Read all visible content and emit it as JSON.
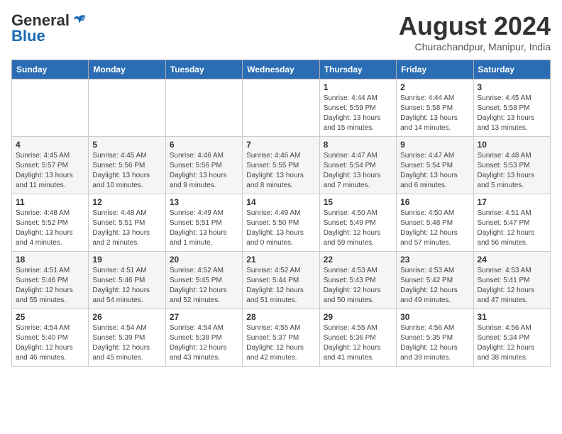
{
  "header": {
    "logo_general": "General",
    "logo_blue": "Blue",
    "month_year": "August 2024",
    "location": "Churachandpur, Manipur, India"
  },
  "weekdays": [
    "Sunday",
    "Monday",
    "Tuesday",
    "Wednesday",
    "Thursday",
    "Friday",
    "Saturday"
  ],
  "weeks": [
    [
      {
        "day": "",
        "info": ""
      },
      {
        "day": "",
        "info": ""
      },
      {
        "day": "",
        "info": ""
      },
      {
        "day": "",
        "info": ""
      },
      {
        "day": "1",
        "info": "Sunrise: 4:44 AM\nSunset: 5:59 PM\nDaylight: 13 hours\nand 15 minutes."
      },
      {
        "day": "2",
        "info": "Sunrise: 4:44 AM\nSunset: 5:58 PM\nDaylight: 13 hours\nand 14 minutes."
      },
      {
        "day": "3",
        "info": "Sunrise: 4:45 AM\nSunset: 5:58 PM\nDaylight: 13 hours\nand 13 minutes."
      }
    ],
    [
      {
        "day": "4",
        "info": "Sunrise: 4:45 AM\nSunset: 5:57 PM\nDaylight: 13 hours\nand 11 minutes."
      },
      {
        "day": "5",
        "info": "Sunrise: 4:45 AM\nSunset: 5:56 PM\nDaylight: 13 hours\nand 10 minutes."
      },
      {
        "day": "6",
        "info": "Sunrise: 4:46 AM\nSunset: 5:56 PM\nDaylight: 13 hours\nand 9 minutes."
      },
      {
        "day": "7",
        "info": "Sunrise: 4:46 AM\nSunset: 5:55 PM\nDaylight: 13 hours\nand 8 minutes."
      },
      {
        "day": "8",
        "info": "Sunrise: 4:47 AM\nSunset: 5:54 PM\nDaylight: 13 hours\nand 7 minutes."
      },
      {
        "day": "9",
        "info": "Sunrise: 4:47 AM\nSunset: 5:54 PM\nDaylight: 13 hours\nand 6 minutes."
      },
      {
        "day": "10",
        "info": "Sunrise: 4:48 AM\nSunset: 5:53 PM\nDaylight: 13 hours\nand 5 minutes."
      }
    ],
    [
      {
        "day": "11",
        "info": "Sunrise: 4:48 AM\nSunset: 5:52 PM\nDaylight: 13 hours\nand 4 minutes."
      },
      {
        "day": "12",
        "info": "Sunrise: 4:48 AM\nSunset: 5:51 PM\nDaylight: 13 hours\nand 2 minutes."
      },
      {
        "day": "13",
        "info": "Sunrise: 4:49 AM\nSunset: 5:51 PM\nDaylight: 13 hours\nand 1 minute."
      },
      {
        "day": "14",
        "info": "Sunrise: 4:49 AM\nSunset: 5:50 PM\nDaylight: 13 hours\nand 0 minutes."
      },
      {
        "day": "15",
        "info": "Sunrise: 4:50 AM\nSunset: 5:49 PM\nDaylight: 12 hours\nand 59 minutes."
      },
      {
        "day": "16",
        "info": "Sunrise: 4:50 AM\nSunset: 5:48 PM\nDaylight: 12 hours\nand 57 minutes."
      },
      {
        "day": "17",
        "info": "Sunrise: 4:51 AM\nSunset: 5:47 PM\nDaylight: 12 hours\nand 56 minutes."
      }
    ],
    [
      {
        "day": "18",
        "info": "Sunrise: 4:51 AM\nSunset: 5:46 PM\nDaylight: 12 hours\nand 55 minutes."
      },
      {
        "day": "19",
        "info": "Sunrise: 4:51 AM\nSunset: 5:46 PM\nDaylight: 12 hours\nand 54 minutes."
      },
      {
        "day": "20",
        "info": "Sunrise: 4:52 AM\nSunset: 5:45 PM\nDaylight: 12 hours\nand 52 minutes."
      },
      {
        "day": "21",
        "info": "Sunrise: 4:52 AM\nSunset: 5:44 PM\nDaylight: 12 hours\nand 51 minutes."
      },
      {
        "day": "22",
        "info": "Sunrise: 4:53 AM\nSunset: 5:43 PM\nDaylight: 12 hours\nand 50 minutes."
      },
      {
        "day": "23",
        "info": "Sunrise: 4:53 AM\nSunset: 5:42 PM\nDaylight: 12 hours\nand 49 minutes."
      },
      {
        "day": "24",
        "info": "Sunrise: 4:53 AM\nSunset: 5:41 PM\nDaylight: 12 hours\nand 47 minutes."
      }
    ],
    [
      {
        "day": "25",
        "info": "Sunrise: 4:54 AM\nSunset: 5:40 PM\nDaylight: 12 hours\nand 46 minutes."
      },
      {
        "day": "26",
        "info": "Sunrise: 4:54 AM\nSunset: 5:39 PM\nDaylight: 12 hours\nand 45 minutes."
      },
      {
        "day": "27",
        "info": "Sunrise: 4:54 AM\nSunset: 5:38 PM\nDaylight: 12 hours\nand 43 minutes."
      },
      {
        "day": "28",
        "info": "Sunrise: 4:55 AM\nSunset: 5:37 PM\nDaylight: 12 hours\nand 42 minutes."
      },
      {
        "day": "29",
        "info": "Sunrise: 4:55 AM\nSunset: 5:36 PM\nDaylight: 12 hours\nand 41 minutes."
      },
      {
        "day": "30",
        "info": "Sunrise: 4:56 AM\nSunset: 5:35 PM\nDaylight: 12 hours\nand 39 minutes."
      },
      {
        "day": "31",
        "info": "Sunrise: 4:56 AM\nSunset: 5:34 PM\nDaylight: 12 hours\nand 38 minutes."
      }
    ]
  ]
}
